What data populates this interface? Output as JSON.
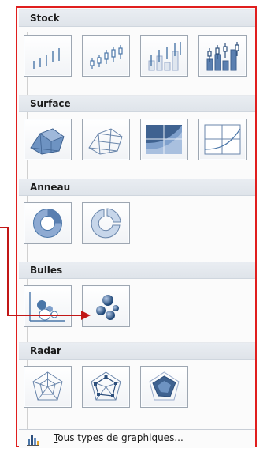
{
  "sections": [
    {
      "key": "stock",
      "title": "Stock"
    },
    {
      "key": "surface",
      "title": "Surface"
    },
    {
      "key": "anneau",
      "title": "Anneau"
    },
    {
      "key": "bulles",
      "title": "Bulles"
    },
    {
      "key": "radar",
      "title": "Radar"
    }
  ],
  "footer": {
    "label_first": "T",
    "label_rest": "ous types de graphiques..."
  },
  "colors": {
    "accent": "#e01e1e",
    "icon_blue": "#4a76a8"
  }
}
